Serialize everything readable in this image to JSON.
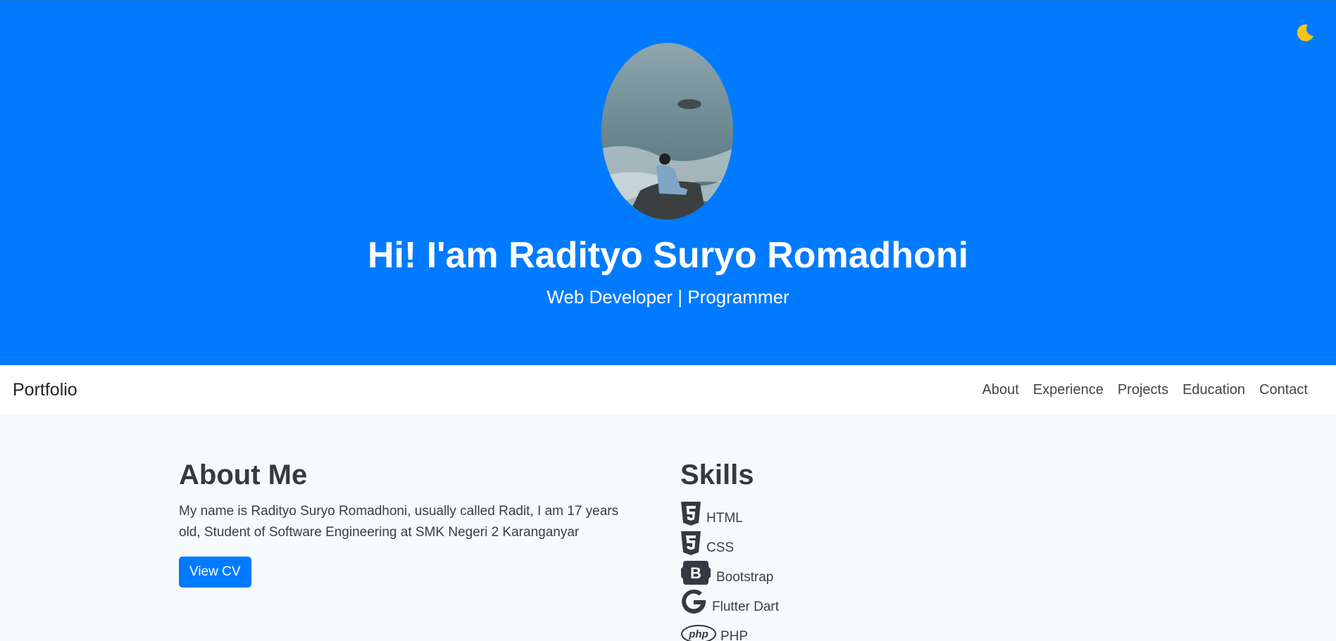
{
  "colors": {
    "primary": "#007bff",
    "background": "#f8f9fa",
    "text": "#343a40"
  },
  "theme_toggle": {
    "icon": "moon-icon"
  },
  "hero": {
    "title": "Hi! I'am Radityo Suryo Romadhoni",
    "subtitle": "Web Developer | Programmer"
  },
  "navbar": {
    "brand": "Portfolio",
    "links": [
      "About",
      "Experience",
      "Projects",
      "Education",
      "Contact"
    ]
  },
  "about": {
    "heading": "About Me",
    "text": "My name is Radityo Suryo Romadhoni, usually called Radit, I am 17 years old, Student of Software Engineering at SMK Negeri 2 Karanganyar",
    "button_label": "View CV"
  },
  "skills": {
    "heading": "Skills",
    "items": [
      {
        "label": "HTML",
        "icon": "html5-icon"
      },
      {
        "label": "CSS",
        "icon": "css3-icon"
      },
      {
        "label": "Bootstrap",
        "icon": "bootstrap-icon"
      },
      {
        "label": "Flutter Dart",
        "icon": "google-icon"
      },
      {
        "label": "PHP",
        "icon": "php-icon"
      }
    ]
  }
}
